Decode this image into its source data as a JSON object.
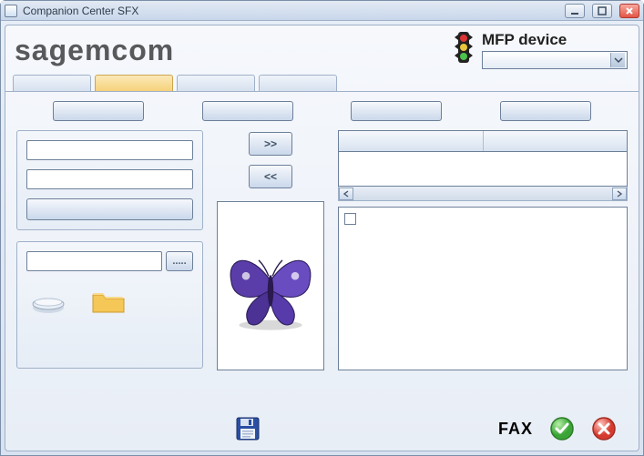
{
  "window": {
    "title": "Companion Center SFX"
  },
  "brand": {
    "text": "sagemcom"
  },
  "device": {
    "label": "MFP device",
    "selected": ""
  },
  "tabs": [
    {
      "label": ""
    },
    {
      "label": ""
    },
    {
      "label": ""
    },
    {
      "label": ""
    }
  ],
  "toolbar": [
    {
      "label": ""
    },
    {
      "label": ""
    },
    {
      "label": ""
    },
    {
      "label": ""
    }
  ],
  "left_panel_inputs": {
    "field1": "",
    "field2": ""
  },
  "browse": {
    "path": "",
    "button_label": "....."
  },
  "arrows": {
    "right": ">>",
    "left": "<<"
  },
  "bottom": {
    "fax_label": "FAX"
  },
  "icons": {
    "app": "app-icon",
    "minimize": "minimize-icon",
    "maximize": "maximize-icon",
    "close": "close-icon",
    "traffic": "traffic-light-icon",
    "dropdown": "chevron-down-icon",
    "scanner": "scanner-icon",
    "folder": "folder-icon",
    "butterfly": "butterfly-image",
    "save": "floppy-disk-icon",
    "ok": "ok-round-icon",
    "cancel": "cancel-round-icon",
    "scroll_left": "scroll-left-icon",
    "scroll_right": "scroll-right-icon"
  }
}
